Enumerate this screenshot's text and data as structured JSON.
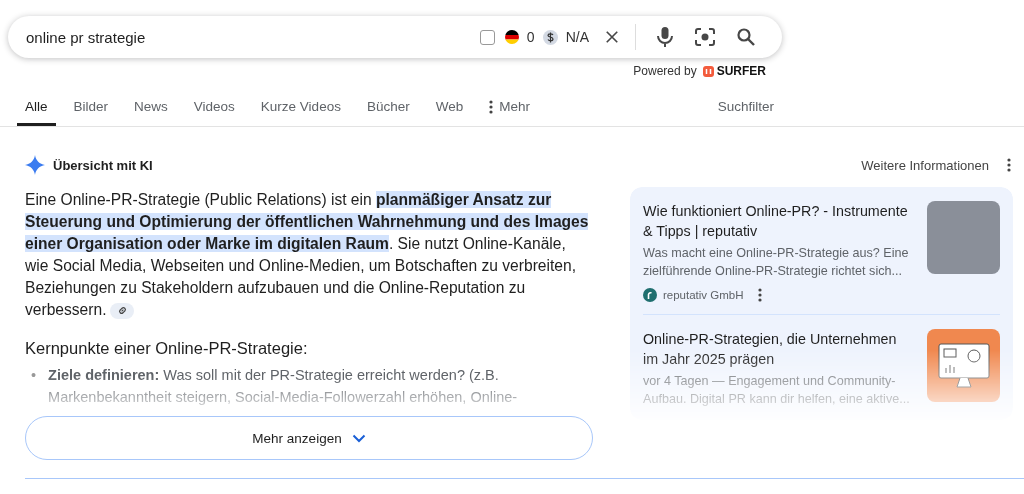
{
  "search": {
    "query": "online pr strategie",
    "checked": false,
    "country_count": "0",
    "price": "N/A"
  },
  "powered_by": {
    "label": "Powered by",
    "brand": "SURFER"
  },
  "tabs": [
    {
      "label": "Alle",
      "selected": true,
      "kind": "tab"
    },
    {
      "label": "Bilder",
      "selected": false,
      "kind": "tab"
    },
    {
      "label": "News",
      "selected": false,
      "kind": "tab"
    },
    {
      "label": "Videos",
      "selected": false,
      "kind": "tab"
    },
    {
      "label": "Kurze Videos",
      "selected": false,
      "kind": "tab"
    },
    {
      "label": "Bücher",
      "selected": false,
      "kind": "tab"
    },
    {
      "label": "Web",
      "selected": false,
      "kind": "tab"
    },
    {
      "label": "Mehr",
      "selected": false,
      "kind": "more"
    }
  ],
  "search_filter": "Suchfilter",
  "ai_overview": {
    "title": "Übersicht mit KI",
    "more_info": "Weitere Informationen",
    "summary": "Eine Online-PR-Strategie (Public Relations) ist ein **planmäßiger Ansatz zur Steuerung und Optimierung der öffentlichen Wahrnehmung und des Images einer Organisation oder Marke im digitalen Raum**. Sie nutzt Online-Kanäle, wie Social Media, Webseiten und Online-Medien, um Botschaften zu verbreiten, Beziehungen zu Stakeholdern aufzubauen und die Online-Reputation zu verbessern.",
    "heading": "Kernpunkte einer Online-PR-Strategie:",
    "points": [
      {
        "marker": "•",
        "text": "**Ziele definieren:** Was soll mit der PR-Strategie erreicht werden? (z.B. Markenbekanntheit steigern, Social-Media-Followerzahl erhöhen, Online-"
      }
    ],
    "show_more": "Mehr anzeigen"
  },
  "sources": [
    {
      "title": "Wie funktioniert Online-PR? - Instrumente & Tipps | reputativ",
      "snippet": "Was macht eine Online-PR-Strategie aus? Eine zielführende Online-PR-Strategie richtet sich...",
      "site": "reputativ GmbH",
      "kind": "photo"
    },
    {
      "title": "Online-PR-Strategien, die Unternehmen im Jahr 2025 prägen",
      "snippet": "vor 4 Tagen — Engagement und Community-Aufbau. Digital PR kann dir helfen, eine aktive...",
      "kind": "illustration"
    }
  ]
}
